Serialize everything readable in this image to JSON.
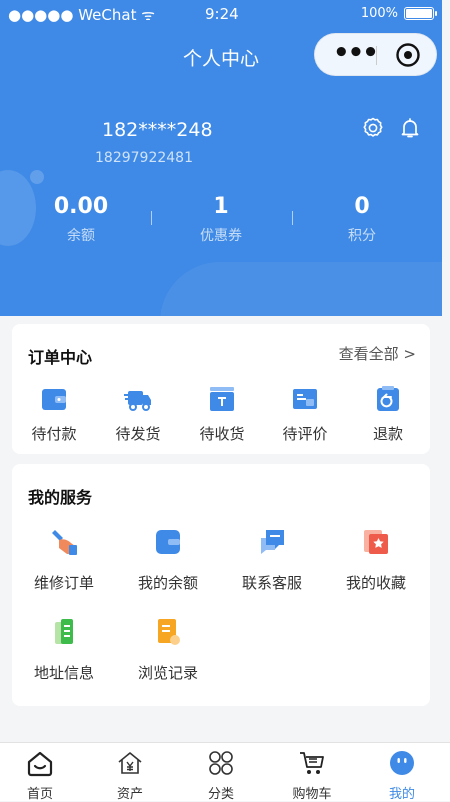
{
  "status_bar": {
    "carrier": "●●●●● WeChat",
    "time": "9:24",
    "battery": "100%"
  },
  "nav": {
    "title": "个人中心"
  },
  "profile": {
    "name": "182****248",
    "phone": "18297922481"
  },
  "stats": [
    {
      "value": "0.00",
      "label": "余额"
    },
    {
      "value": "1",
      "label": "优惠券"
    },
    {
      "value": "0",
      "label": "积分"
    }
  ],
  "orders": {
    "title": "订单中心",
    "view_all": "查看全部 >",
    "items": [
      {
        "label": "待付款",
        "icon": "wallet-icon"
      },
      {
        "label": "待发货",
        "icon": "truck-icon"
      },
      {
        "label": "待收货",
        "icon": "box-icon"
      },
      {
        "label": "待评价",
        "icon": "comment-card-icon"
      },
      {
        "label": "退款",
        "icon": "refund-icon"
      }
    ]
  },
  "services": {
    "title": "我的服务",
    "items": [
      {
        "label": "维修订单",
        "icon": "wrench-hand-icon"
      },
      {
        "label": "我的余额",
        "icon": "wallet-icon"
      },
      {
        "label": "联系客服",
        "icon": "chat-icon"
      },
      {
        "label": "我的收藏",
        "icon": "star-folder-icon"
      },
      {
        "label": "地址信息",
        "icon": "address-doc-icon"
      },
      {
        "label": "浏览记录",
        "icon": "history-doc-icon"
      }
    ]
  },
  "tabbar": {
    "active": "我的",
    "items": [
      {
        "label": "首页",
        "icon": "home-icon"
      },
      {
        "label": "资产",
        "icon": "yuan-house-icon"
      },
      {
        "label": "分类",
        "icon": "grid-icon"
      },
      {
        "label": "购物车",
        "icon": "cart-icon"
      },
      {
        "label": "我的",
        "icon": "profile-face-icon"
      }
    ]
  },
  "colors": {
    "primary": "#3f8ae6",
    "background": "#f4f5f7"
  }
}
